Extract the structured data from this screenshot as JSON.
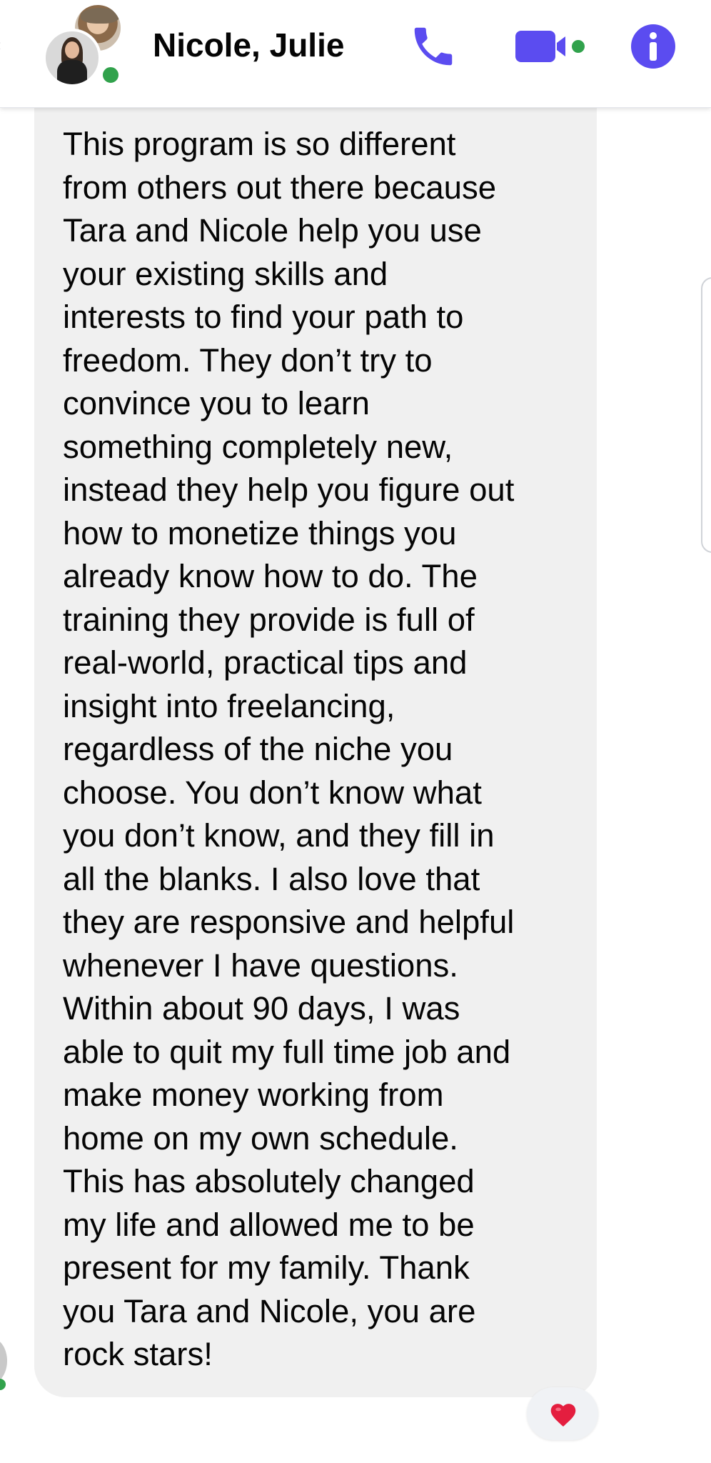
{
  "header": {
    "title": "Nicole, Julie",
    "call_icon": "phone-icon",
    "video_icon": "video-camera-icon",
    "info_icon": "info-icon"
  },
  "message": {
    "text": "This program is so different\nfrom others out there because\nTara and Nicole help you use\nyour existing skills and\ninterests to find your path to\nfreedom. They don’t try to\nconvince you to learn\nsomething completely new,\ninstead they help you figure out\nhow to monetize things you\nalready know how to do. The\ntraining they provide is full of\nreal-world, practical tips and\ninsight into freelancing,\nregardless of the niche you\nchoose. You don’t know what\nyou don’t know, and they fill in\nall the blanks. I also love that\nthey are responsive and helpful\nwhenever I have questions.\nWithin about 90 days, I was\nable to quit my full time job and\nmake money working from\nhome on my own schedule.\nThis has absolutely changed\nmy life and allowed me to be\npresent for my family. Thank\nyou Tara and Nicole, you are\nrock stars!",
    "reaction": "heart-icon"
  },
  "colors": {
    "accent": "#5b4cf0",
    "online": "#31a24c",
    "bubble": "#f0f0f0",
    "heart": "#e41e3f"
  }
}
